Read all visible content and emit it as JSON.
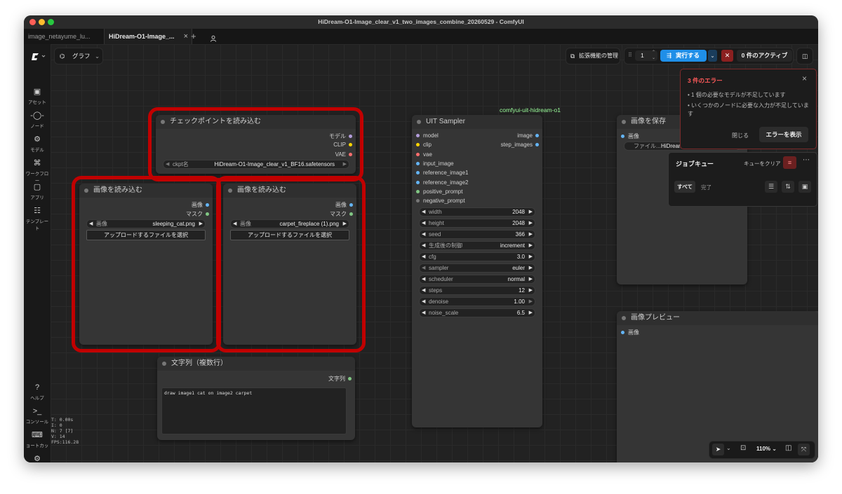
{
  "window": {
    "title": "HiDream-O1-Image_clear_v1_two_images_combine_20260529 - ComfyUI"
  },
  "tabs": [
    {
      "label": "image_netayume_lu..."
    },
    {
      "label": "HiDream-O1-Image_..."
    }
  ],
  "sidebar": {
    "items": [
      {
        "label": "アセット",
        "icon": "assets-icon"
      },
      {
        "label": "ノード",
        "icon": "node-icon"
      },
      {
        "label": "モデル",
        "icon": "model-icon"
      },
      {
        "label": "ワークフロー",
        "icon": "workflow-icon"
      },
      {
        "label": "アプリ",
        "icon": "app-icon"
      },
      {
        "label": "テンプレート",
        "icon": "template-icon"
      }
    ],
    "bottom_items": [
      {
        "label": "ヘルプ",
        "icon": "help-icon"
      },
      {
        "label": "コンソール",
        "icon": "console-icon"
      },
      {
        "label": "ョートカッ",
        "icon": "keyboard-icon"
      },
      {
        "label": "設定",
        "icon": "gear-icon"
      }
    ]
  },
  "toolbar": {
    "graph_label": "グラフ",
    "extensions_label": "拡張機能の管理",
    "queue_count": "1",
    "run_label": "実行する",
    "active_label": "0 件のアクティブ"
  },
  "error_panel": {
    "title": "3 件のエラー",
    "items": [
      "1 個の必要なモデルが不足しています",
      "いくつかのノードに必要な入力が不足しています"
    ],
    "close_label": "閉じる",
    "show_label": "エラーを表示"
  },
  "job_queue": {
    "title": "ジョブキュー",
    "clear_label": "キューをクリア",
    "tab_all": "すべて",
    "tab_done": "完了"
  },
  "group_label": "comfyui-uit-hidream-o1",
  "nodes": {
    "checkpoint": {
      "title": "チェックポイントを読み込む",
      "outputs": [
        "モデル",
        "CLIP",
        "VAE"
      ],
      "ckpt_label": "ckpt名",
      "ckpt_value": "HiDream-O1-Image_clear_v1_BF16.safetensors"
    },
    "load_image_1": {
      "title": "画像を読み込む",
      "outputs": [
        "画像",
        "マスク"
      ],
      "image_label": "画像",
      "image_value": "sleeping_cat.png",
      "upload_label": "アップロードするファイルを選択"
    },
    "load_image_2": {
      "title": "画像を読み込む",
      "outputs": [
        "画像",
        "マスク"
      ],
      "image_label": "画像",
      "image_value": "carpet_fireplace (1).png",
      "upload_label": "アップロードするファイルを選択"
    },
    "text_multiline": {
      "title": "文字列（複数行）",
      "output": "文字列",
      "text": "draw image1 cat on image2 carpet"
    },
    "sampler": {
      "title": "UIT Sampler",
      "inputs": [
        "model",
        "clip",
        "vae",
        "input_image",
        "reference_image1",
        "reference_image2",
        "positive_prompt",
        "negative_prompt"
      ],
      "outputs": [
        "image",
        "step_images"
      ],
      "widgets": [
        {
          "label": "width",
          "value": "2048"
        },
        {
          "label": "height",
          "value": "2048"
        },
        {
          "label": "seed",
          "value": "366"
        },
        {
          "label": "生成後の制御",
          "value": "increment"
        },
        {
          "label": "cfg",
          "value": "3.0"
        },
        {
          "label": "sampler",
          "value": "euler"
        },
        {
          "label": "scheduler",
          "value": "normal"
        },
        {
          "label": "steps",
          "value": "12"
        },
        {
          "label": "denoise",
          "value": "1.00"
        },
        {
          "label": "noise_scale",
          "value": "6.5"
        }
      ]
    },
    "save_image": {
      "title": "画像を保存",
      "input": "画像",
      "file_label": "ファイル...",
      "file_value": "HiDream"
    },
    "preview_image": {
      "title": "画像プレビュー",
      "input": "画像"
    }
  },
  "stats": [
    "T: 0.00s",
    "I: 0",
    "N: 7 [7]",
    "V: 14",
    "FPS:116.28"
  ],
  "bottom_toolbar": {
    "zoom": "110%"
  },
  "colors": {
    "highlight_red": "#c10000",
    "run_blue": "#1f8fe8",
    "error_red": "#ff5a5a"
  }
}
